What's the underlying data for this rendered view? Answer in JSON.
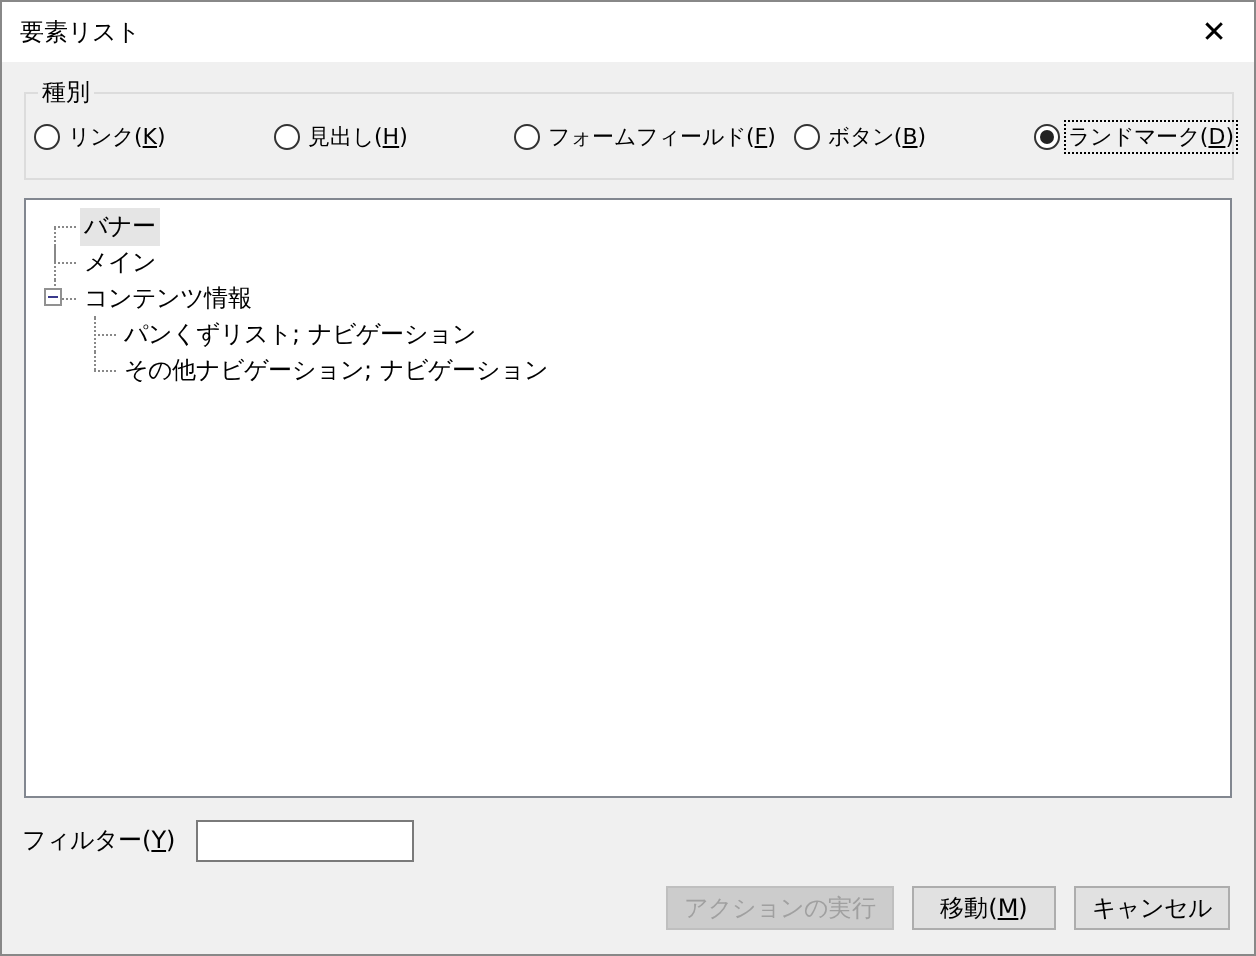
{
  "window": {
    "title": "要素リスト",
    "close": "✕"
  },
  "type_group": {
    "title": "種別",
    "options": [
      {
        "before": "リンク(",
        "key": "K",
        "after": ")",
        "selected": false
      },
      {
        "before": "見出し(",
        "key": "H",
        "after": ")",
        "selected": false
      },
      {
        "before": "フォームフィールド(",
        "key": "F",
        "after": ")",
        "selected": false
      },
      {
        "before": "ボタン(",
        "key": "B",
        "after": ")",
        "selected": false
      },
      {
        "before": "ランドマーク(",
        "key": "D",
        "after": ")",
        "selected": true
      }
    ]
  },
  "tree": [
    {
      "label": "バナー",
      "selected": true
    },
    {
      "label": "メイン",
      "selected": false
    },
    {
      "label": "コンテンツ情報",
      "selected": false,
      "expanded": true,
      "children": [
        {
          "label": "パンくずリスト; ナビゲーション",
          "selected": false
        },
        {
          "label": "その他ナビゲーション; ナビゲーション",
          "selected": false
        }
      ]
    }
  ],
  "filter": {
    "before": "フィルター(",
    "key": "Y",
    "after": ")"
  },
  "buttons": [
    {
      "before": "アクションの実行",
      "disabled": true
    },
    {
      "before": "移動(",
      "key": "M",
      "after": ")",
      "disabled": false
    },
    {
      "before": "キャンセル",
      "disabled": false
    }
  ]
}
